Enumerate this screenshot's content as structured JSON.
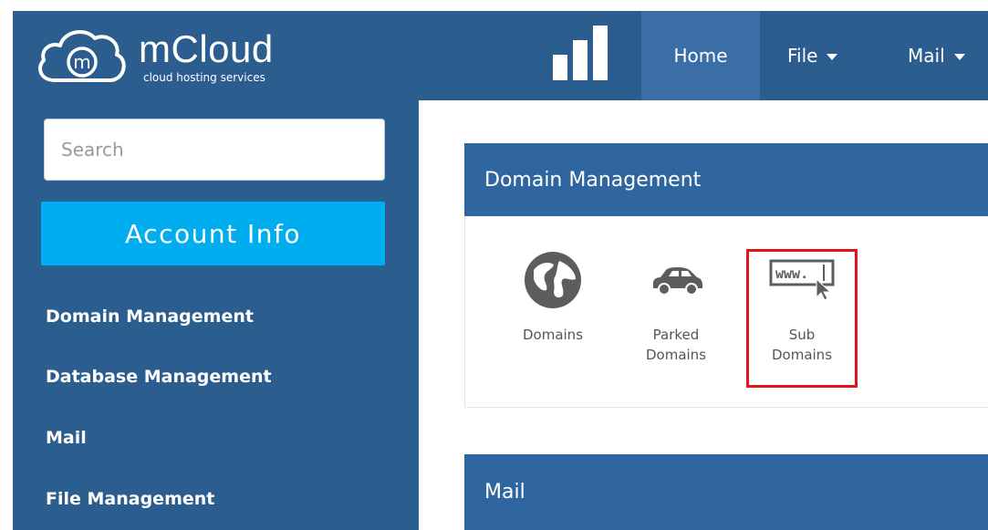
{
  "header": {
    "logo_title": "mCloud",
    "logo_subtitle": "cloud hosting services",
    "logo_letter": "m",
    "nav": [
      {
        "label": "Home",
        "active": true
      },
      {
        "label": "File",
        "dropdown": true
      },
      {
        "label": "Mail",
        "dropdown": true
      }
    ]
  },
  "sidebar": {
    "search_placeholder": "Search",
    "account_button": "Account Info",
    "items": [
      {
        "label": "Domain Management"
      },
      {
        "label": "Database Management"
      },
      {
        "label": "Mail"
      },
      {
        "label": "File Management"
      }
    ]
  },
  "main": {
    "sections": [
      {
        "title": "Domain Management",
        "tiles": [
          {
            "label_line1": "Domains",
            "label_line2": "",
            "icon": "globe-icon"
          },
          {
            "label_line1": "Parked",
            "label_line2": "Domains",
            "icon": "car-icon"
          },
          {
            "label_line1": "Sub",
            "label_line2": "Domains",
            "icon": "www-cursor-icon",
            "highlighted": true
          }
        ]
      },
      {
        "title": "Mail",
        "tiles": []
      }
    ],
    "www_text": "www."
  },
  "colors": {
    "navbar": "#2c5d8f",
    "nav_active": "#3b6ea5",
    "panel_header": "#2f66a0",
    "account_button": "#00aeef",
    "highlight": "#e3141b"
  }
}
